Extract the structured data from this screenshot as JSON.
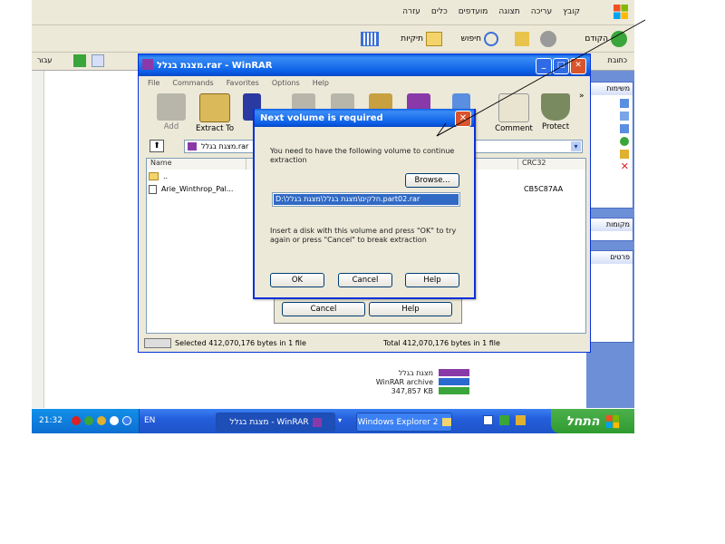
{
  "explorer": {
    "menus": [
      "קובץ",
      "עריכה",
      "תצוגה",
      "מועדפים",
      "כלים",
      "עזרה"
    ],
    "back_label": "הקודם",
    "search_label": "חיפוש",
    "folders_label": "תיקיות",
    "address_label": "כתובת",
    "go_label": "עבור",
    "side_panel": [
      "משימות",
      "מקומות",
      "פרטים"
    ],
    "rar_file": {
      "name": "מצגת בגלל",
      "type": "WinRAR archive",
      "size": "347,857 KB"
    }
  },
  "winrar": {
    "title": "מצגת בגלל.rar - WinRAR",
    "menu": [
      "File",
      "Commands",
      "Favorites",
      "Options",
      "Help"
    ],
    "tools": [
      "Add",
      "Extract To",
      "Comment",
      "Protect"
    ],
    "path": "מצגת בגלל.rar",
    "columns": [
      "Name",
      "CRC32"
    ],
    "rows": [
      {
        "name": "..",
        "crc": ""
      },
      {
        "name": "Arie_Winthrop_Pal...",
        "crc": "CB5C87AA"
      }
    ],
    "status_left": "Selected 412,070,176 bytes in 1 file",
    "status_right": "Total 412,070,176 bytes in 1 file"
  },
  "back_dialog": {
    "cancel": "Cancel",
    "help": "Help"
  },
  "next_volume_dialog": {
    "title": "Next volume is required",
    "message": "You need to have the following volume to continue extraction",
    "browse": "Browse...",
    "volume_path": "D:\\חלקים\\מצגת בגלל\\מצגת בגלל.part02.rar",
    "instruction": "Insert a disk with this volume and press \"OK\" to try again or press \"Cancel\" to break extraction",
    "ok": "OK",
    "cancel": "Cancel",
    "help": "Help"
  },
  "taskbar": {
    "start": "התחל",
    "tasks": [
      "Windows Explorer 2",
      "מצגת בגלל - WinRAR"
    ],
    "lang": "EN",
    "clock": "21:32"
  }
}
